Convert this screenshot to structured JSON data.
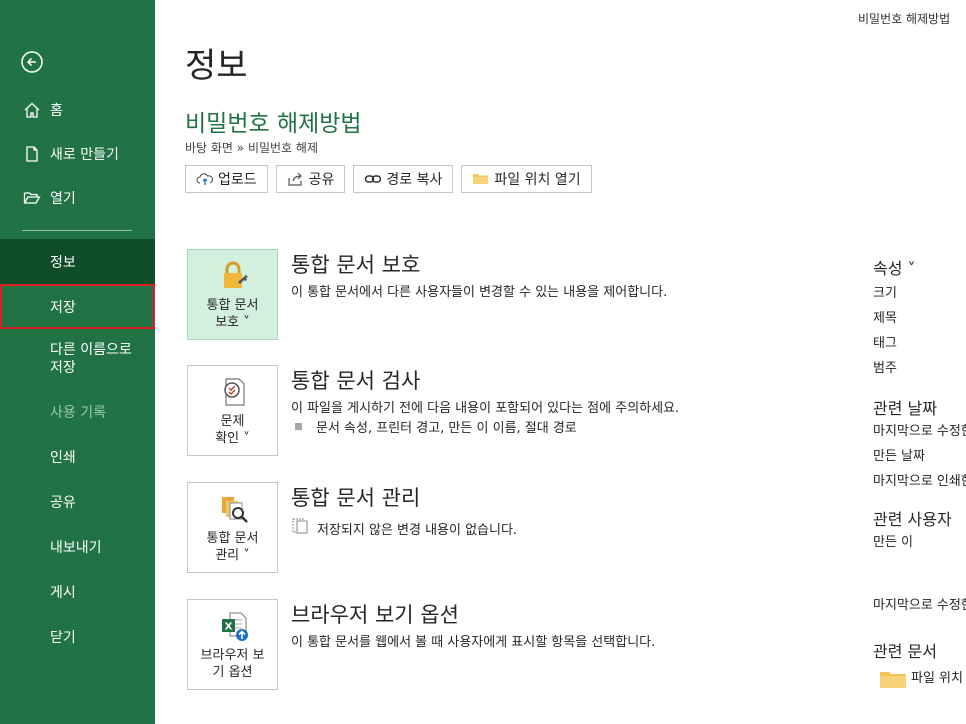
{
  "sidebar": {
    "top_items": [
      {
        "label": "홈",
        "icon": "home-icon"
      },
      {
        "label": "새로 만들기",
        "icon": "new-document-icon"
      },
      {
        "label": "열기",
        "icon": "open-folder-icon"
      }
    ],
    "main_items": [
      {
        "label": "정보"
      },
      {
        "label": "저장"
      },
      {
        "label": "다른 이름으로 저장"
      },
      {
        "label": "사용 기록"
      },
      {
        "label": "인쇄"
      },
      {
        "label": "공유"
      },
      {
        "label": "내보내기"
      },
      {
        "label": "게시"
      },
      {
        "label": "닫기"
      }
    ]
  },
  "window_title": "비밀번호 해제방법",
  "page_title": "정보",
  "document": {
    "title": "비밀번호 해제방법",
    "path": "바탕 화면 » 비밀번호 해제"
  },
  "actions": [
    {
      "label": "업로드",
      "icon": "upload-icon"
    },
    {
      "label": "공유",
      "icon": "share-icon"
    },
    {
      "label": "경로 복사",
      "icon": "link-icon"
    },
    {
      "label": "파일 위치 열기",
      "icon": "folder-icon"
    }
  ],
  "sections": [
    {
      "tile_label_1": "통합 문서",
      "tile_label_2": "보호 ˅",
      "title": "통합 문서 보호",
      "desc": "이 통합 문서에서 다른 사용자들이 변경할 수 있는 내용을 제어합니다."
    },
    {
      "tile_label_1": "문제",
      "tile_label_2": "확인 ˅",
      "title": "통합 문서 검사",
      "desc": "이 파일을 게시하기 전에 다음 내용이 포함되어 있다는 점에 주의하세요.",
      "sub": "문서 속성, 프린터 경고, 만든 이 이름, 절대 경로"
    },
    {
      "tile_label_1": "통합 문서",
      "tile_label_2": "관리 ˅",
      "title": "통합 문서 관리",
      "sub": "저장되지 않은 변경 내용이 없습니다."
    },
    {
      "tile_label_1": "브라우저 보",
      "tile_label_2": "기 옵션",
      "title": "브라우저 보기 옵션",
      "desc": "이 통합 문서를 웹에서 볼 때 사용자에게 표시할 항목을 선택합니다."
    }
  ],
  "properties": {
    "header": "속성 ˅",
    "rows": [
      "크기",
      "제목",
      "태그",
      "범주"
    ],
    "dates_header": "관련 날짜",
    "dates": [
      "마지막으로 수정한 날짜",
      "만든 날짜",
      "마지막으로 인쇄한 날짜"
    ],
    "people_header": "관련 사용자",
    "people": [
      "만든 이",
      "마지막으로 수정한 사람"
    ],
    "docs_header": "관련 문서",
    "docs_item": "파일 위치 열기"
  },
  "colors": {
    "sidebar": "#217346",
    "sidebar_active": "#0e4d28",
    "highlight_border": "#e02020",
    "accent_text": "#217346",
    "tile_active": "#d3f0df"
  }
}
